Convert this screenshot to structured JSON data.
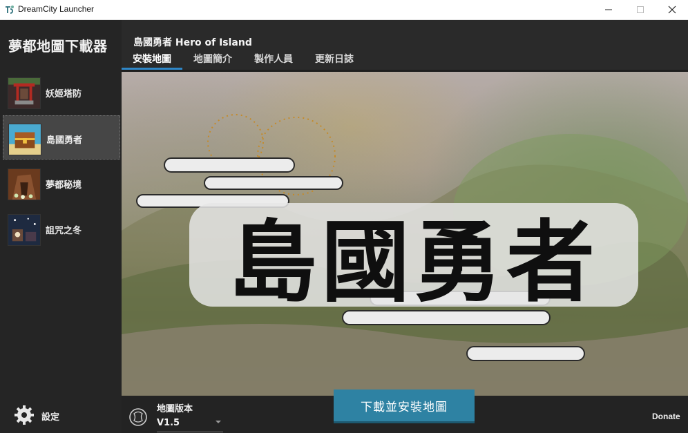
{
  "window": {
    "title": "DreamCity Launcher",
    "icon": "dreamcity-logo-icon",
    "controls": [
      "minimize-icon",
      "maximize-icon",
      "close-icon"
    ]
  },
  "sidebar": {
    "title": "夢都地圖下載器",
    "selected_index": 1,
    "items": [
      {
        "label": "妖姬塔防",
        "icon": "yaoji-tower-defense-thumbnail"
      },
      {
        "label": "島國勇者",
        "icon": "island-hero-treasure-chest-thumbnail"
      },
      {
        "label": "夢都秘境",
        "icon": "dream-realm-tree-thumbnail"
      },
      {
        "label": "詛咒之冬",
        "icon": "cursed-winter-thumbnail"
      }
    ],
    "settings": {
      "label": "設定",
      "icon": "gear-icon"
    }
  },
  "header": {
    "map_title": "島國勇者 Hero of Island",
    "tabs": [
      "安裝地圖",
      "地圖簡介",
      "製作人員",
      "更新日誌"
    ],
    "active_tab_index": 0
  },
  "banner": {
    "logo_text": "島國勇者",
    "description": "ink-wash landscape painting with brush-calligraphy title"
  },
  "footer": {
    "version_label": "地圖版本",
    "version_value": "V1.5",
    "version_icon": "warcraft-logo-icon",
    "download_button": "下載並安裝地圖",
    "donate_link": "Donate"
  },
  "colors": {
    "accent": "#2f87c7",
    "download_button": "#2e82a3",
    "sidebar_bg": "#252525",
    "header_bg": "#2a2a2a",
    "active_item_bg": "#464646"
  }
}
